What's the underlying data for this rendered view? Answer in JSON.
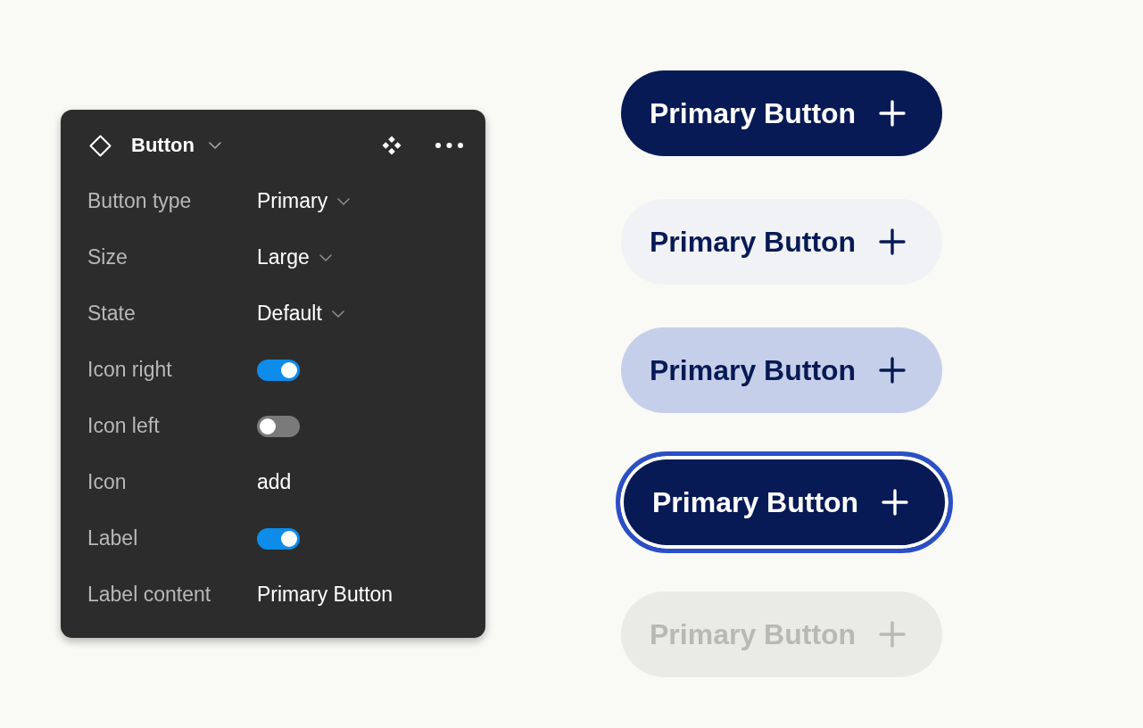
{
  "panel": {
    "title": "Button",
    "properties": [
      {
        "kind": "dropdown",
        "label": "Button type",
        "value": "Primary"
      },
      {
        "kind": "dropdown",
        "label": "Size",
        "value": "Large"
      },
      {
        "kind": "dropdown",
        "label": "State",
        "value": "Default"
      },
      {
        "kind": "toggle",
        "label": "Icon right",
        "on": true
      },
      {
        "kind": "toggle",
        "label": "Icon left",
        "on": false
      },
      {
        "kind": "text",
        "label": "Icon",
        "value": "add"
      },
      {
        "kind": "toggle",
        "label": "Label",
        "on": true
      },
      {
        "kind": "text",
        "label": "Label content",
        "value": "Primary Button"
      }
    ]
  },
  "buttons": [
    {
      "label": "Primary Button",
      "kind": "solid",
      "focused": false,
      "disabled": false
    },
    {
      "label": "Primary Button",
      "kind": "subtle",
      "focused": false,
      "disabled": false
    },
    {
      "label": "Primary Button",
      "kind": "tonal",
      "focused": false,
      "disabled": false
    },
    {
      "label": "Primary Button",
      "kind": "solid",
      "focused": true,
      "disabled": false
    },
    {
      "label": "Primary Button",
      "kind": "solid",
      "focused": false,
      "disabled": true
    }
  ]
}
